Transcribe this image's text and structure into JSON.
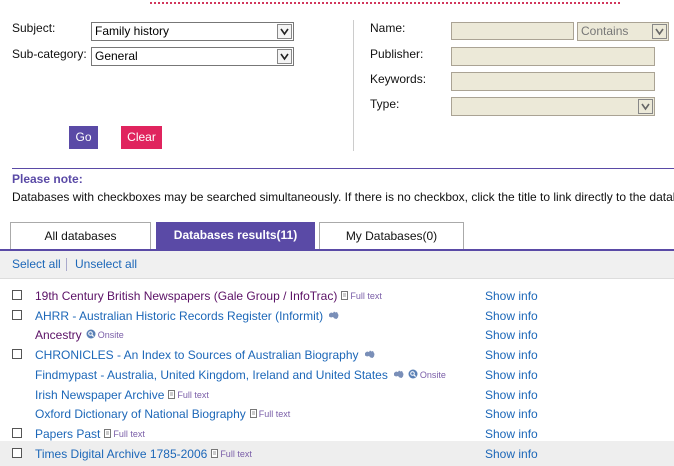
{
  "form": {
    "subject_label": "Subject:",
    "subject_value": "Family history",
    "subcategory_label": "Sub-category:",
    "subcategory_value": "General",
    "name_label": "Name:",
    "name_value": "",
    "match_value": "Contains",
    "publisher_label": "Publisher:",
    "keywords_label": "Keywords:",
    "type_label": "Type:",
    "type_value": "",
    "go_label": "Go",
    "clear_label": "Clear"
  },
  "note": {
    "title": "Please note:",
    "text": "Databases with checkboxes may be searched simultaneously. If there is no checkbox, click the title to link directly to the database."
  },
  "tabs": [
    {
      "label": "All databases",
      "active": false
    },
    {
      "label": "Databases results(11)",
      "active": true
    },
    {
      "label": "My Databases(0)",
      "active": false
    }
  ],
  "select_all": "Select all",
  "unselect_all": "Unselect all",
  "show_info": "Show info",
  "results": [
    {
      "name": "19th Century British Newspapers (Gale Group / InfoTrac)",
      "checkbox": true,
      "visited": true,
      "badge": "Full text",
      "badge_icon": "document-icon",
      "flag": false
    },
    {
      "name": "AHRR - Australian Historic Records Register (Informit)",
      "checkbox": true,
      "visited": false,
      "badge": "",
      "badge_icon": "",
      "flag": true
    },
    {
      "name": "Ancestry",
      "checkbox": false,
      "visited": true,
      "badge": "Onsite",
      "badge_icon": "search-icon",
      "flag": false
    },
    {
      "name": "CHRONICLES - An Index to Sources of Australian Biography",
      "checkbox": true,
      "visited": false,
      "badge": "",
      "badge_icon": "",
      "flag": true
    },
    {
      "name": "Findmypast - Australia, United Kingdom, Ireland and United States",
      "checkbox": false,
      "visited": false,
      "badge": "Onsite",
      "badge_icon": "search-icon",
      "flag": true
    },
    {
      "name": "Irish Newspaper Archive",
      "checkbox": false,
      "visited": false,
      "badge": "Full text",
      "badge_icon": "document-icon",
      "flag": false
    },
    {
      "name": "Oxford Dictionary of National Biography",
      "checkbox": false,
      "visited": false,
      "badge": "Full text",
      "badge_icon": "document-icon",
      "flag": false
    },
    {
      "name": "Papers Past",
      "checkbox": true,
      "visited": false,
      "badge": "Full text",
      "badge_icon": "document-icon",
      "flag": false
    },
    {
      "name": "Times Digital Archive 1785-2006",
      "checkbox": true,
      "visited": false,
      "badge": "Full text",
      "badge_icon": "document-icon",
      "flag": false
    }
  ],
  "colors": {
    "accent_purple": "#5a4aa6",
    "clear_red": "#e0245e",
    "link_blue": "#1c67b8",
    "visited_purple": "#5b1166",
    "field_tan": "#ece9d8"
  }
}
